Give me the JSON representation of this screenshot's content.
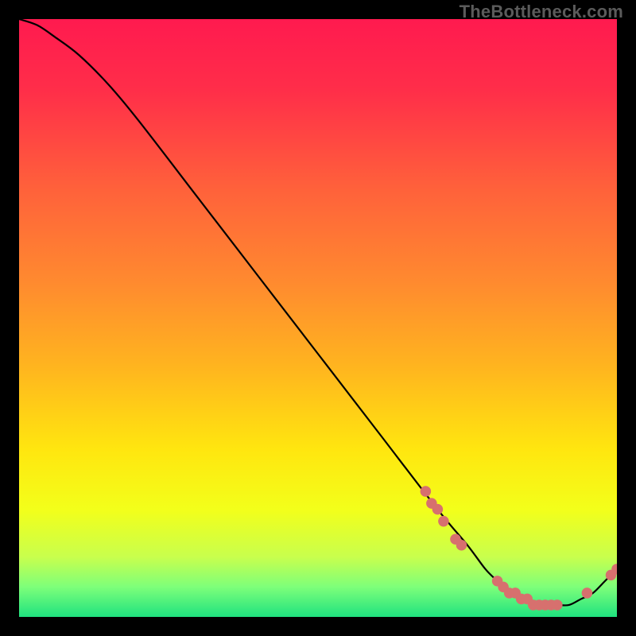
{
  "watermark": "TheBottleneck.com",
  "gradient_stops": [
    {
      "offset": 0.0,
      "color": "#ff1a4f"
    },
    {
      "offset": 0.12,
      "color": "#ff2e49"
    },
    {
      "offset": 0.28,
      "color": "#ff603b"
    },
    {
      "offset": 0.44,
      "color": "#ff8a2f"
    },
    {
      "offset": 0.58,
      "color": "#ffb41f"
    },
    {
      "offset": 0.72,
      "color": "#ffe60f"
    },
    {
      "offset": 0.82,
      "color": "#f3ff1a"
    },
    {
      "offset": 0.9,
      "color": "#c8ff4d"
    },
    {
      "offset": 0.95,
      "color": "#7dff7a"
    },
    {
      "offset": 1.0,
      "color": "#1fe27f"
    }
  ],
  "chart_data": {
    "type": "line",
    "title": "",
    "xlabel": "",
    "ylabel": "",
    "xlim": [
      0,
      100
    ],
    "ylim": [
      0,
      100
    ],
    "series": [
      {
        "name": "curve",
        "x": [
          0,
          3,
          6,
          10,
          15,
          20,
          30,
          40,
          50,
          60,
          70,
          75,
          78,
          80,
          82,
          84,
          86,
          88,
          90,
          92,
          94,
          96,
          98,
          100
        ],
        "y": [
          100,
          99,
          97,
          94,
          89,
          83,
          70,
          57,
          44,
          31,
          18,
          12,
          8,
          6,
          4,
          3,
          2,
          2,
          2,
          2,
          3,
          4,
          6,
          8
        ]
      }
    ],
    "markers": [
      {
        "x": 68,
        "y": 21
      },
      {
        "x": 69,
        "y": 19
      },
      {
        "x": 70,
        "y": 18
      },
      {
        "x": 71,
        "y": 16
      },
      {
        "x": 73,
        "y": 13
      },
      {
        "x": 74,
        "y": 12
      },
      {
        "x": 80,
        "y": 6
      },
      {
        "x": 81,
        "y": 5
      },
      {
        "x": 82,
        "y": 4
      },
      {
        "x": 83,
        "y": 4
      },
      {
        "x": 84,
        "y": 3
      },
      {
        "x": 85,
        "y": 3
      },
      {
        "x": 86,
        "y": 2
      },
      {
        "x": 87,
        "y": 2
      },
      {
        "x": 88,
        "y": 2
      },
      {
        "x": 89,
        "y": 2
      },
      {
        "x": 90,
        "y": 2
      },
      {
        "x": 95,
        "y": 4
      },
      {
        "x": 99,
        "y": 7
      },
      {
        "x": 100,
        "y": 8
      }
    ],
    "marker_color": "#d7706e",
    "line_color": "#000000",
    "line_width": 2.2
  }
}
